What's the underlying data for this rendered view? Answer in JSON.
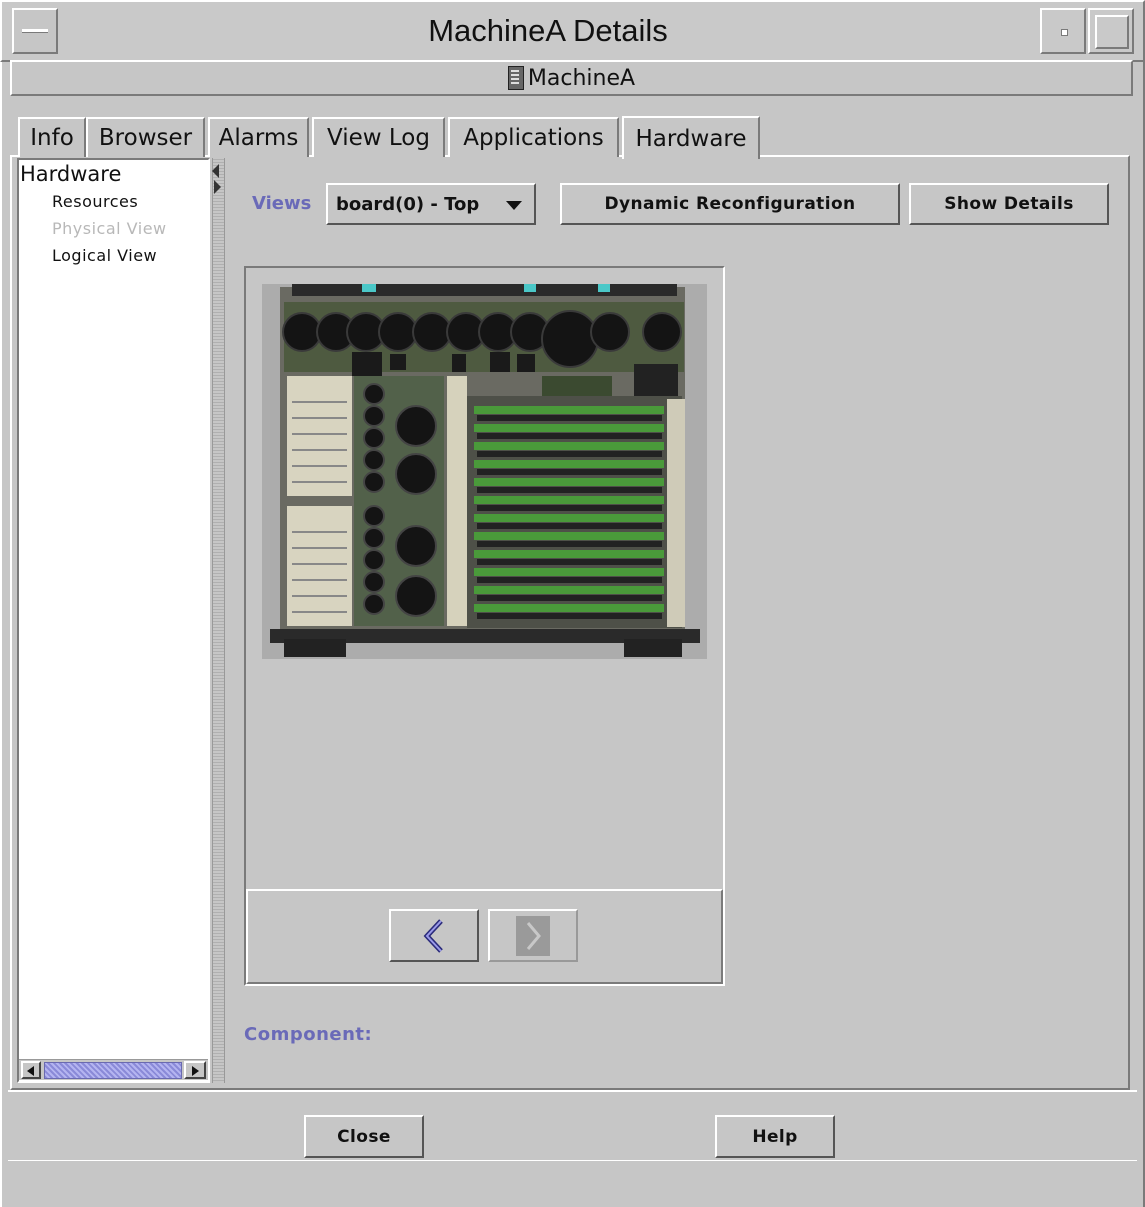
{
  "window": {
    "title": "MachineA Details"
  },
  "host": {
    "name": "MachineA"
  },
  "tabs": [
    {
      "label": "Info"
    },
    {
      "label": "Browser"
    },
    {
      "label": "Alarms"
    },
    {
      "label": "View Log"
    },
    {
      "label": "Applications"
    },
    {
      "label": "Hardware",
      "active": true
    }
  ],
  "tree": {
    "root": "Hardware",
    "items": [
      {
        "label": "Resources",
        "enabled": true
      },
      {
        "label": "Physical View",
        "enabled": false
      },
      {
        "label": "Logical View",
        "enabled": true
      }
    ]
  },
  "toolbar": {
    "views_label": "Views",
    "views_selected": "board(0) - Top",
    "dynamic_reconfig_label": "Dynamic Reconfiguration",
    "show_details_label": "Show Details"
  },
  "component": {
    "label": "Component:"
  },
  "footer": {
    "close_label": "Close",
    "help_label": "Help"
  },
  "colors": {
    "background": "#c6c6c6",
    "accent_label": "#6a6ab8",
    "disabled_text": "#b8b8b8",
    "board_green": "#4a9a3a"
  },
  "icons": {
    "host": "server-icon",
    "prev": "chevron-left-icon",
    "next": "chevron-right-icon"
  }
}
